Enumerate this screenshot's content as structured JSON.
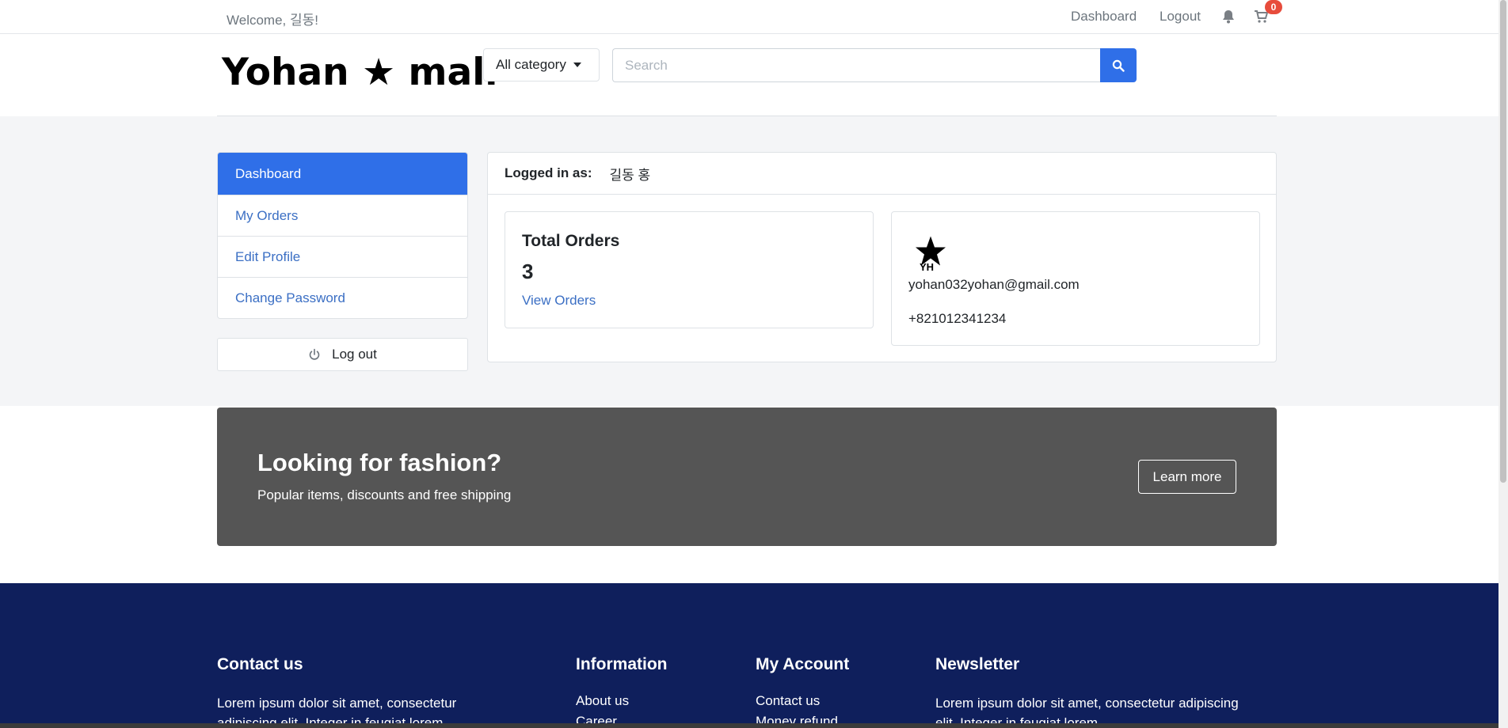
{
  "topbar": {
    "welcome": "Welcome, 길동!",
    "dashboard_link": "Dashboard",
    "logout_link": "Logout",
    "cart_count": "0"
  },
  "header": {
    "logo": "Yohan ★ mall",
    "category_label": "All category",
    "search_placeholder": "Search"
  },
  "sidebar": {
    "items": [
      {
        "label": "Dashboard",
        "active": true
      },
      {
        "label": "My Orders"
      },
      {
        "label": "Edit Profile"
      },
      {
        "label": "Change Password"
      }
    ],
    "logout_label": "Log out"
  },
  "account": {
    "logged_in_label": "Logged in as:",
    "user_name": "길동 홍",
    "total_orders_title": "Total Orders",
    "total_orders_count": "3",
    "view_orders_link": "View Orders",
    "avatar_initials": "YH",
    "email": "yohan032yohan@gmail.com",
    "phone": "+821012341234"
  },
  "banner": {
    "title": "Looking for fashion?",
    "subtitle": "Popular items, discounts and free shipping",
    "button": "Learn more"
  },
  "footer": {
    "contact": {
      "title": "Contact us",
      "text_line1": "Lorem ipsum dolor sit amet, consectetur",
      "text_line2": "adipiscing elit. Integer in feugiat lorem."
    },
    "information": {
      "title": "Information",
      "link1": "About us",
      "link2": "Career"
    },
    "my_account": {
      "title": "My Account",
      "link1": "Contact us",
      "link2": "Money refund"
    },
    "newsletter": {
      "title": "Newsletter",
      "text_line1": "Lorem ipsum dolor sit amet, consectetur adipiscing",
      "text_line2": "elit. Integer in feugiat lorem."
    }
  },
  "colors": {
    "primary": "#2f6fe8",
    "link": "#3b6fc4",
    "banner_bg": "#555555",
    "footer_bg": "#0f1f5c",
    "badge": "#e74c3c"
  }
}
